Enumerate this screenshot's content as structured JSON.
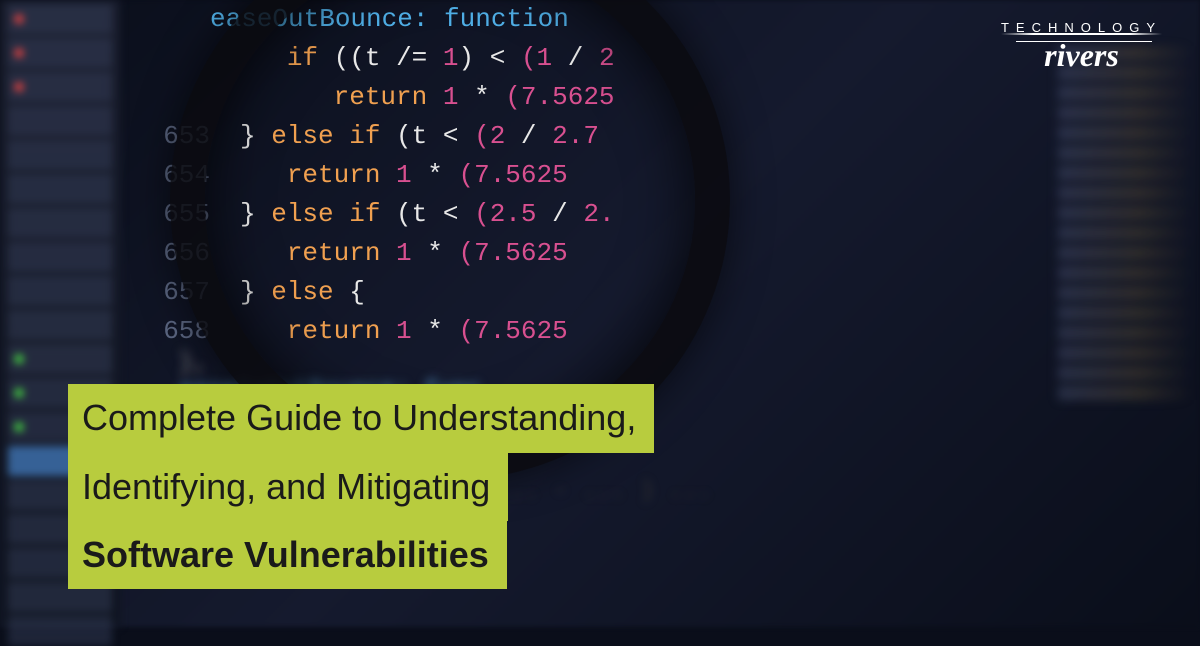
{
  "logo": {
    "top": "TECHNOLOGY",
    "bottom": "rivers"
  },
  "title": {
    "line1": "Complete Guide to Understanding,",
    "line2": "Identifying, and Mitigating",
    "line3": "Software Vulnerabilities"
  },
  "code": {
    "header": "easeOutBounce: function",
    "lines": [
      {
        "num": "",
        "text": "if ((t /= 1) < (1 / 2",
        "indent": 3
      },
      {
        "num": "",
        "text": "return 1 * (7.5625",
        "indent": 5
      },
      {
        "num": "653",
        "text": "} else if (t < (2 / 2.7",
        "indent": 2
      },
      {
        "num": "654",
        "text": "return 1 * (7.5625",
        "indent": 5
      },
      {
        "num": "655",
        "text": "} else if (t < (2.5 / 2.",
        "indent": 2
      },
      {
        "num": "656",
        "text": "return 1 * (7.5625",
        "indent": 5
      },
      {
        "num": "657",
        "text": "} else {",
        "indent": 2
      },
      {
        "num": "658",
        "text": "return 1 * (7.5625",
        "indent": 5
      }
    ],
    "footer1": "},",
    "footer2": "easeInOutBounce: func"
  }
}
